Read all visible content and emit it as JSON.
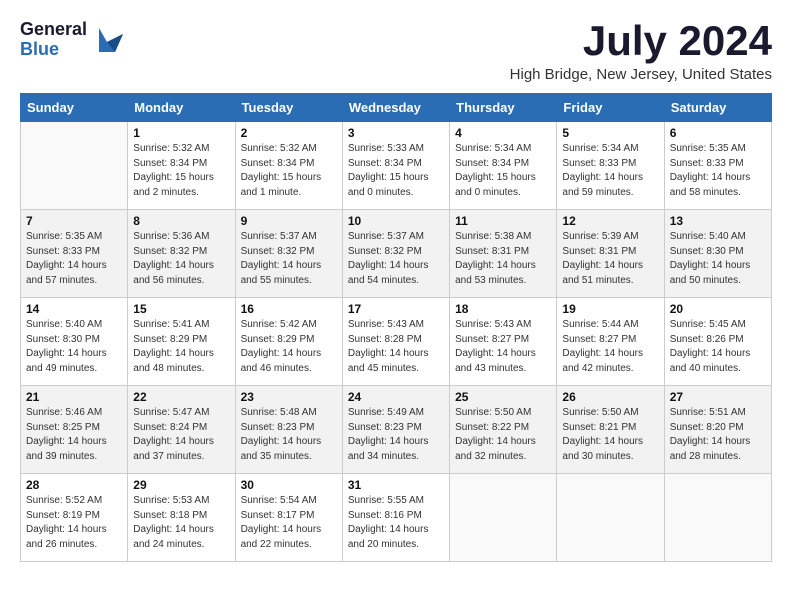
{
  "logo": {
    "general": "General",
    "blue": "Blue"
  },
  "title": {
    "month": "July 2024",
    "location": "High Bridge, New Jersey, United States"
  },
  "headers": [
    "Sunday",
    "Monday",
    "Tuesday",
    "Wednesday",
    "Thursday",
    "Friday",
    "Saturday"
  ],
  "weeks": [
    [
      {
        "day": "",
        "info": ""
      },
      {
        "day": "1",
        "info": "Sunrise: 5:32 AM\nSunset: 8:34 PM\nDaylight: 15 hours\nand 2 minutes."
      },
      {
        "day": "2",
        "info": "Sunrise: 5:32 AM\nSunset: 8:34 PM\nDaylight: 15 hours\nand 1 minute."
      },
      {
        "day": "3",
        "info": "Sunrise: 5:33 AM\nSunset: 8:34 PM\nDaylight: 15 hours\nand 0 minutes."
      },
      {
        "day": "4",
        "info": "Sunrise: 5:34 AM\nSunset: 8:34 PM\nDaylight: 15 hours\nand 0 minutes."
      },
      {
        "day": "5",
        "info": "Sunrise: 5:34 AM\nSunset: 8:33 PM\nDaylight: 14 hours\nand 59 minutes."
      },
      {
        "day": "6",
        "info": "Sunrise: 5:35 AM\nSunset: 8:33 PM\nDaylight: 14 hours\nand 58 minutes."
      }
    ],
    [
      {
        "day": "7",
        "info": "Sunrise: 5:35 AM\nSunset: 8:33 PM\nDaylight: 14 hours\nand 57 minutes."
      },
      {
        "day": "8",
        "info": "Sunrise: 5:36 AM\nSunset: 8:32 PM\nDaylight: 14 hours\nand 56 minutes."
      },
      {
        "day": "9",
        "info": "Sunrise: 5:37 AM\nSunset: 8:32 PM\nDaylight: 14 hours\nand 55 minutes."
      },
      {
        "day": "10",
        "info": "Sunrise: 5:37 AM\nSunset: 8:32 PM\nDaylight: 14 hours\nand 54 minutes."
      },
      {
        "day": "11",
        "info": "Sunrise: 5:38 AM\nSunset: 8:31 PM\nDaylight: 14 hours\nand 53 minutes."
      },
      {
        "day": "12",
        "info": "Sunrise: 5:39 AM\nSunset: 8:31 PM\nDaylight: 14 hours\nand 51 minutes."
      },
      {
        "day": "13",
        "info": "Sunrise: 5:40 AM\nSunset: 8:30 PM\nDaylight: 14 hours\nand 50 minutes."
      }
    ],
    [
      {
        "day": "14",
        "info": "Sunrise: 5:40 AM\nSunset: 8:30 PM\nDaylight: 14 hours\nand 49 minutes."
      },
      {
        "day": "15",
        "info": "Sunrise: 5:41 AM\nSunset: 8:29 PM\nDaylight: 14 hours\nand 48 minutes."
      },
      {
        "day": "16",
        "info": "Sunrise: 5:42 AM\nSunset: 8:29 PM\nDaylight: 14 hours\nand 46 minutes."
      },
      {
        "day": "17",
        "info": "Sunrise: 5:43 AM\nSunset: 8:28 PM\nDaylight: 14 hours\nand 45 minutes."
      },
      {
        "day": "18",
        "info": "Sunrise: 5:43 AM\nSunset: 8:27 PM\nDaylight: 14 hours\nand 43 minutes."
      },
      {
        "day": "19",
        "info": "Sunrise: 5:44 AM\nSunset: 8:27 PM\nDaylight: 14 hours\nand 42 minutes."
      },
      {
        "day": "20",
        "info": "Sunrise: 5:45 AM\nSunset: 8:26 PM\nDaylight: 14 hours\nand 40 minutes."
      }
    ],
    [
      {
        "day": "21",
        "info": "Sunrise: 5:46 AM\nSunset: 8:25 PM\nDaylight: 14 hours\nand 39 minutes."
      },
      {
        "day": "22",
        "info": "Sunrise: 5:47 AM\nSunset: 8:24 PM\nDaylight: 14 hours\nand 37 minutes."
      },
      {
        "day": "23",
        "info": "Sunrise: 5:48 AM\nSunset: 8:23 PM\nDaylight: 14 hours\nand 35 minutes."
      },
      {
        "day": "24",
        "info": "Sunrise: 5:49 AM\nSunset: 8:23 PM\nDaylight: 14 hours\nand 34 minutes."
      },
      {
        "day": "25",
        "info": "Sunrise: 5:50 AM\nSunset: 8:22 PM\nDaylight: 14 hours\nand 32 minutes."
      },
      {
        "day": "26",
        "info": "Sunrise: 5:50 AM\nSunset: 8:21 PM\nDaylight: 14 hours\nand 30 minutes."
      },
      {
        "day": "27",
        "info": "Sunrise: 5:51 AM\nSunset: 8:20 PM\nDaylight: 14 hours\nand 28 minutes."
      }
    ],
    [
      {
        "day": "28",
        "info": "Sunrise: 5:52 AM\nSunset: 8:19 PM\nDaylight: 14 hours\nand 26 minutes."
      },
      {
        "day": "29",
        "info": "Sunrise: 5:53 AM\nSunset: 8:18 PM\nDaylight: 14 hours\nand 24 minutes."
      },
      {
        "day": "30",
        "info": "Sunrise: 5:54 AM\nSunset: 8:17 PM\nDaylight: 14 hours\nand 22 minutes."
      },
      {
        "day": "31",
        "info": "Sunrise: 5:55 AM\nSunset: 8:16 PM\nDaylight: 14 hours\nand 20 minutes."
      },
      {
        "day": "",
        "info": ""
      },
      {
        "day": "",
        "info": ""
      },
      {
        "day": "",
        "info": ""
      }
    ]
  ]
}
